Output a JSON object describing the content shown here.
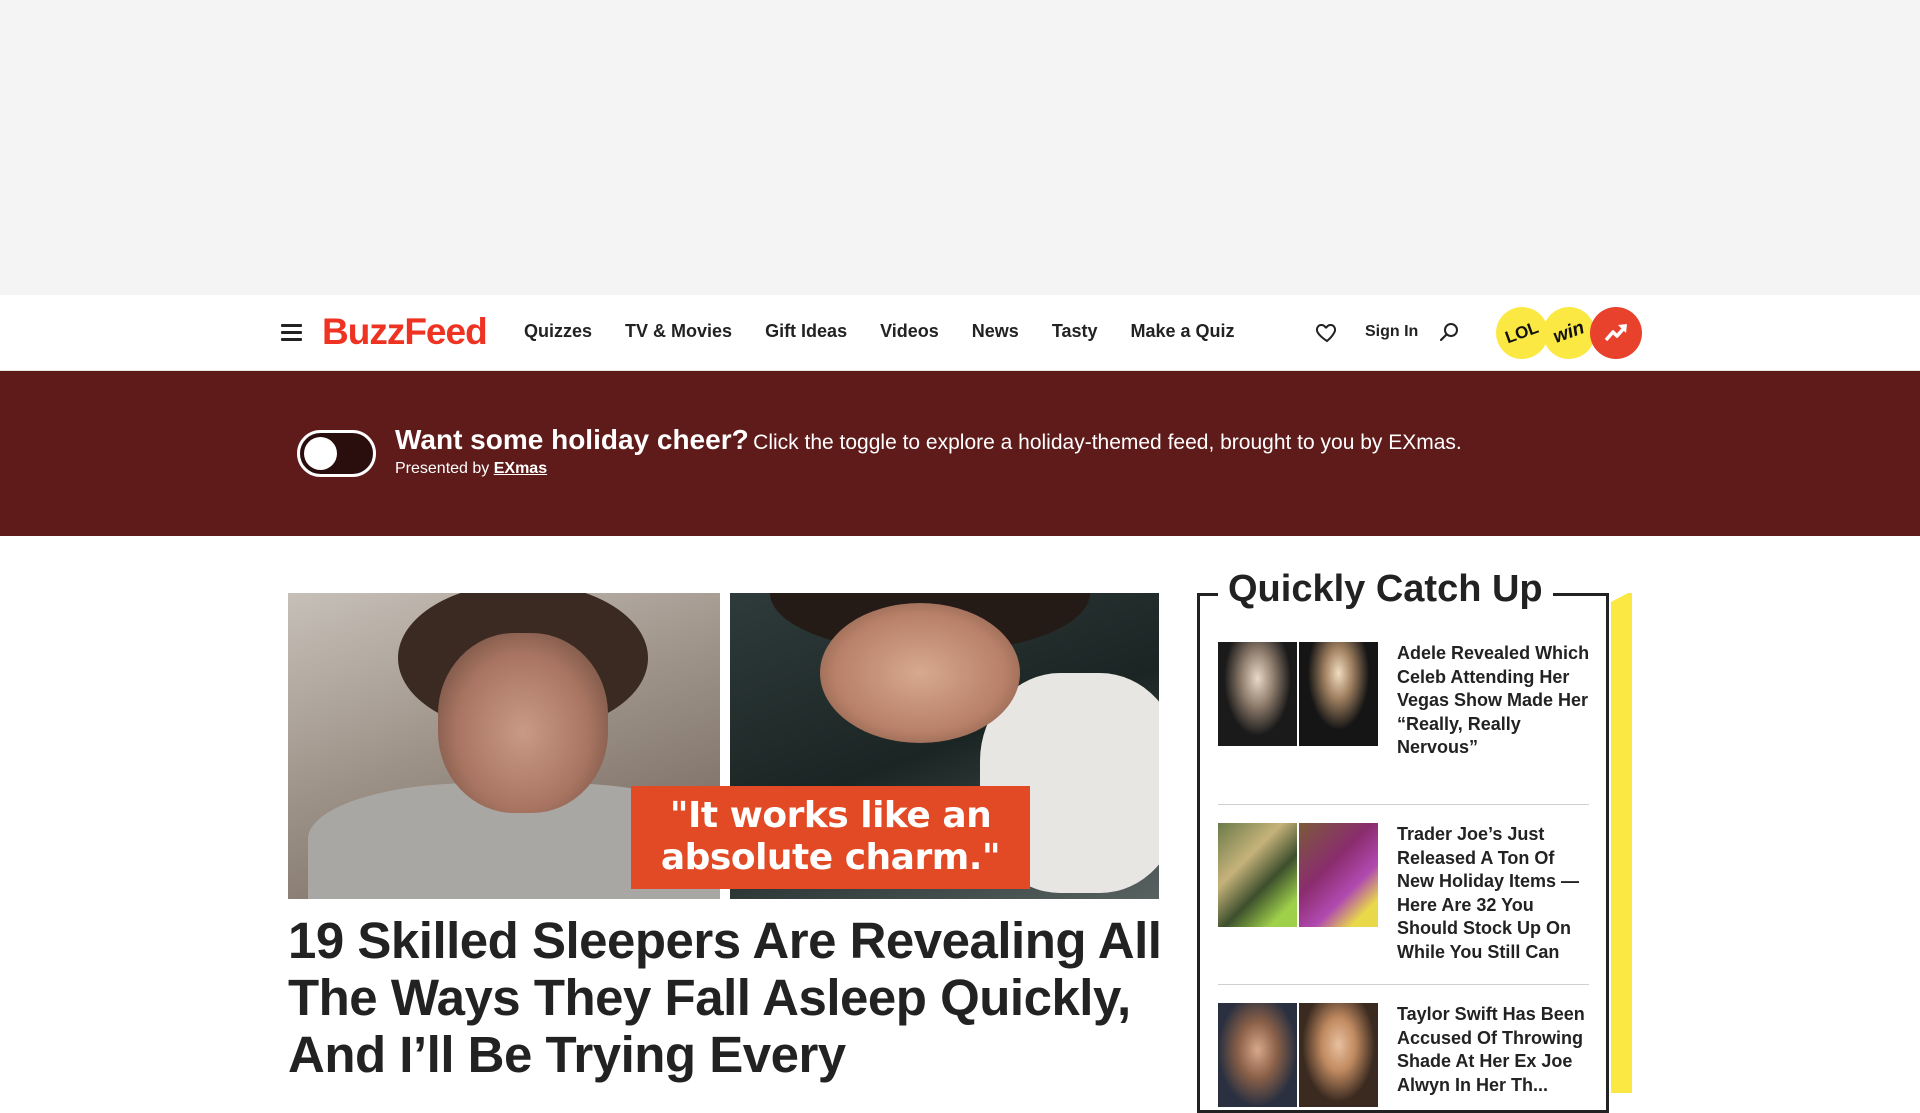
{
  "nav": {
    "logo": "BuzzFeed",
    "links": [
      "Quizzes",
      "TV & Movies",
      "Gift Ideas",
      "Videos",
      "News",
      "Tasty",
      "Make a Quiz"
    ],
    "sign_in": "Sign In",
    "badges": {
      "lol": "LOL",
      "win": "win"
    }
  },
  "promo": {
    "headline": "Want some holiday cheer?",
    "text": "Click the toggle to explore a holiday-themed feed, brought to you by EXmas.",
    "presented_prefix": "Presented by",
    "sponsor": "EXmas"
  },
  "hero": {
    "caption_line1": "\"It works like an",
    "caption_line2": "absolute charm.\"",
    "headline": "19 Skilled Sleepers Are Revealing All The Ways They Fall Asleep Quickly, And I’ll Be Trying Every"
  },
  "catchup": {
    "title": "Quickly Catch Up",
    "items": [
      {
        "title": "Adele Revealed Which Celeb Attending Her Vegas Show Made Her “Really, Really Nervous”"
      },
      {
        "title": "Trader Joe’s Just Released A Ton Of New Holiday Items — Here Are 32 You Should Stock Up On While You Still Can"
      },
      {
        "title": "Taylor Swift Has Been Accused Of Throwing Shade At Her Ex Joe Alwyn In Her Th..."
      }
    ]
  },
  "colors": {
    "brand_red": "#e32222",
    "promo_bg": "#5f1a1a",
    "accent_yellow": "#fbe843",
    "caption_orange": "#e24a26"
  }
}
